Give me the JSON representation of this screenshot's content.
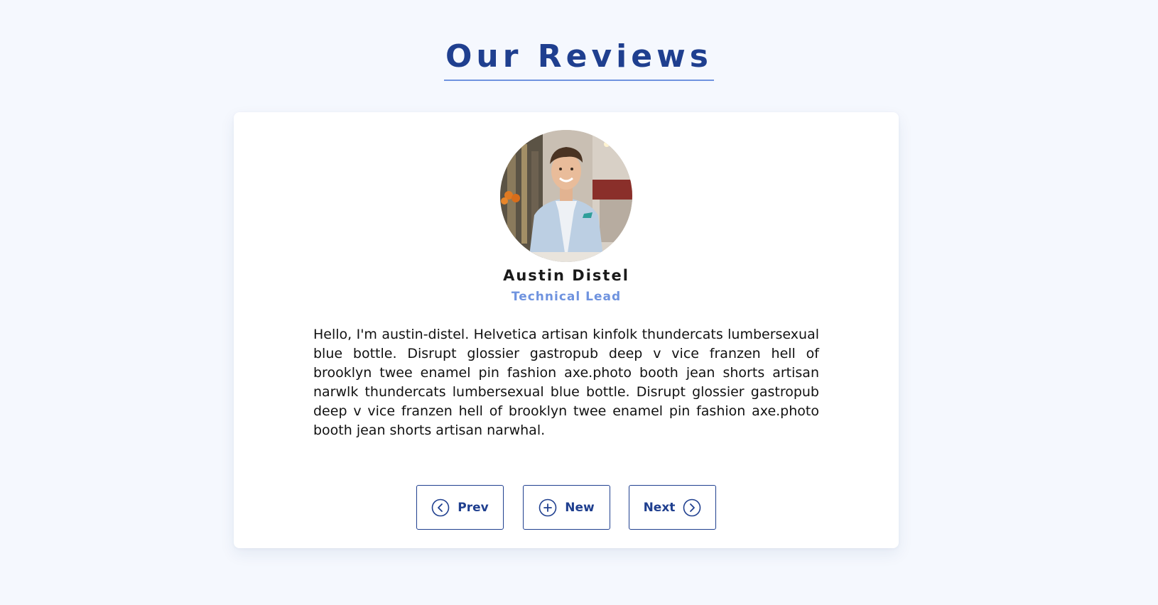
{
  "section": {
    "title": "Our Reviews"
  },
  "review": {
    "name": "Austin Distel",
    "job": "Technical Lead",
    "text": "Hello, I'm austin-distel. Helvetica artisan kinfolk thundercats lumbersexual blue bottle. Disrupt glossier gastropub deep v vice franzen hell of brooklyn twee enamel pin fashion axe.photo booth jean shorts artisan narwlk thundercats lumbersexual blue bottle. Disrupt glossier gastropub deep v vice franzen hell of brooklyn twee enamel pin fashion axe.photo booth jean shorts artisan narwhal."
  },
  "controls": {
    "prev_label": "Prev",
    "new_label": "New",
    "next_label": "Next"
  },
  "icons": {
    "prev": "chevron-left-circle-icon",
    "new": "plus-circle-icon",
    "next": "chevron-right-circle-icon"
  },
  "colors": {
    "background": "#f5f8fe",
    "title": "#1f3f8f",
    "title_underline": "#6f93df",
    "accent": "#6f93df",
    "button_border": "#1f3f8f",
    "card": "#ffffff"
  }
}
